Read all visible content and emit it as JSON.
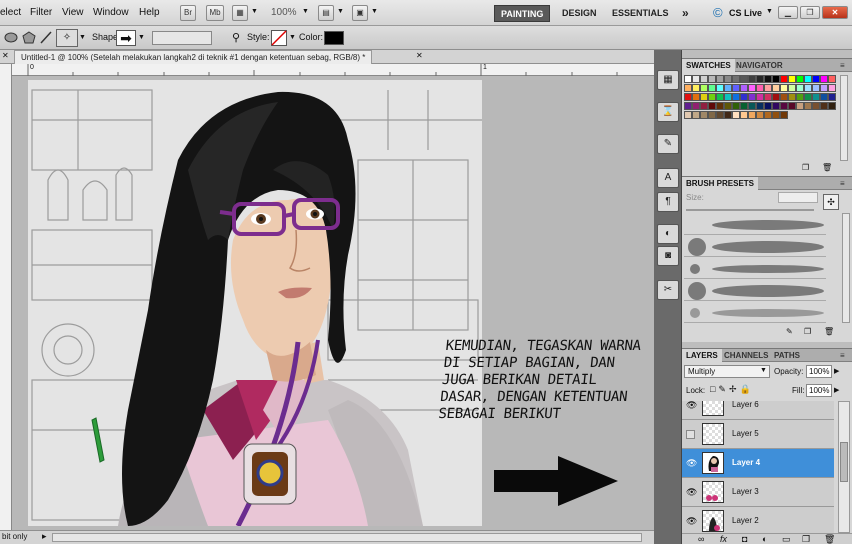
{
  "menubar": {
    "items": [
      "elect",
      "Filter",
      "View",
      "Window",
      "Help"
    ],
    "icon_buttons": [
      "Br",
      "Mb"
    ],
    "zoom": "100%",
    "workspaces": [
      "PAINTING",
      "DESIGN",
      "ESSENTIALS"
    ],
    "overflow": "»",
    "cslive": "CS Live"
  },
  "options": {
    "shape_label": "Shape:",
    "style_label": "Style:",
    "color_label": "Color:",
    "color_value": "#000000"
  },
  "document": {
    "tab_title": "Untitled-1 @ 100% (Setelah melakukan langkah2 di teknik #1 dengan ketentuan  sebag, RGB/8) *",
    "ruler_marks": [
      "0",
      "1"
    ],
    "caption": "KEMUDIAN, TEGASKAN WARNA DI SETIAP BAGIAN, DAN JUGA BERIKAN DETAIL DASAR, DENGAN KETENTUAN SEBAGAI BERIKUT"
  },
  "status": {
    "text": "bit only"
  },
  "swatches": {
    "tabs": [
      "SWATCHES",
      "NAVIGATOR"
    ],
    "colors": [
      "#ffffff",
      "#e8e8e8",
      "#d0d0d0",
      "#b8b8b8",
      "#a0a0a0",
      "#888888",
      "#707070",
      "#585858",
      "#404040",
      "#282828",
      "#101010",
      "#000000",
      "#ff0000",
      "#ffff00",
      "#00ff00",
      "#00ffff",
      "#0000ff",
      "#ff00ff",
      "#ff6060",
      "#ffb060",
      "#fff060",
      "#b0ff60",
      "#60ff90",
      "#60ffff",
      "#60b0ff",
      "#6060ff",
      "#b060ff",
      "#ff60ff",
      "#ff60b0",
      "#ffa0a0",
      "#ffd0a0",
      "#ffffa0",
      "#d0ffa0",
      "#a0ffd0",
      "#a0e0ff",
      "#a0c0ff",
      "#c0a0ff",
      "#ffa0e0",
      "#e01010",
      "#e07010",
      "#e0d010",
      "#70d010",
      "#10c050",
      "#10c0c0",
      "#1070e0",
      "#3030d0",
      "#8030d0",
      "#d030a0",
      "#d03060",
      "#a01010",
      "#a05010",
      "#a09010",
      "#50a010",
      "#10904a",
      "#109090",
      "#1050a0",
      "#202090",
      "#602090",
      "#902070",
      "#902040",
      "#600808",
      "#603008",
      "#605808",
      "#306008",
      "#086030",
      "#085858",
      "#083060",
      "#081060",
      "#300860",
      "#580840",
      "#580828",
      "#c8a080",
      "#a07850",
      "#785030",
      "#503018",
      "#302010",
      "#e0c8b0",
      "#c0a888",
      "#a08868",
      "#806848",
      "#604830",
      "#402818",
      "#ffe0c0",
      "#ffc890",
      "#f0a860",
      "#d08840",
      "#b06820",
      "#905010",
      "#703808"
    ]
  },
  "brushes": {
    "tabs": [
      "BRUSH PRESETS"
    ],
    "size_label": "Size:",
    "count": 5
  },
  "layers": {
    "tabs": [
      "LAYERS",
      "CHANNELS",
      "PATHS"
    ],
    "blend_mode": "Multiply",
    "opacity_label": "Opacity:",
    "opacity": "100%",
    "lock_label": "Lock:",
    "fill_label": "Fill:",
    "fill": "100%",
    "rows": [
      {
        "name": "Layer 6",
        "visible": true,
        "selected": false
      },
      {
        "name": "Layer 5",
        "visible": false,
        "selected": false
      },
      {
        "name": "Layer 4",
        "visible": true,
        "selected": true
      },
      {
        "name": "Layer 3",
        "visible": true,
        "selected": false
      },
      {
        "name": "Layer 2",
        "visible": true,
        "selected": false
      }
    ],
    "footer_icons": [
      "link-icon",
      "fx-icon",
      "mask-icon",
      "adjustment-icon",
      "folder-icon",
      "new-layer-icon",
      "trash-icon"
    ]
  }
}
